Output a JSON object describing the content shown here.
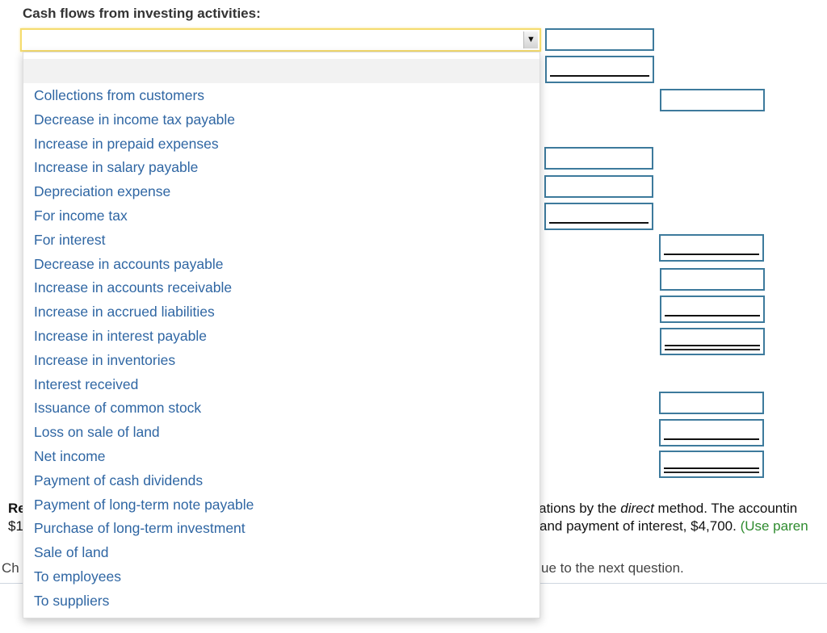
{
  "section": {
    "heading": "Cash flows from investing activities:"
  },
  "select": {
    "value": "",
    "arrow_icon": "triangle-down"
  },
  "dropdown": {
    "options": [
      "Collections from customers",
      "Decrease in income tax payable",
      "Increase in prepaid expenses",
      "Increase in salary payable",
      "Depreciation expense",
      "For income tax",
      "For interest",
      "Decrease in accounts payable",
      "Increase in accounts receivable",
      "Increase in accrued liabilities",
      "Increase in interest payable",
      "Increase in inventories",
      "Interest received",
      "Issuance of common stock",
      "Loss on sale of land",
      "Net income",
      "Payment of cash dividends",
      "Payment of long-term note payable",
      "Purchase of long-term investment",
      "Sale of land",
      "To employees",
      "To suppliers"
    ]
  },
  "inputs": {
    "values": [
      "",
      "",
      "",
      "",
      "",
      "",
      "",
      "",
      "",
      "",
      "",
      "",
      ""
    ]
  },
  "question": {
    "line1_left": "Re",
    "line1_right_a": "erations by the ",
    "line1_right_em": "direct",
    "line1_right_b": " method. The accountin",
    "line2_left": "$1",
    "line2_right": "and payment of interest, $4,700. ",
    "line2_hint": "(Use paren",
    "footer_left": "Ch",
    "footer_right": "ue to the next question."
  }
}
